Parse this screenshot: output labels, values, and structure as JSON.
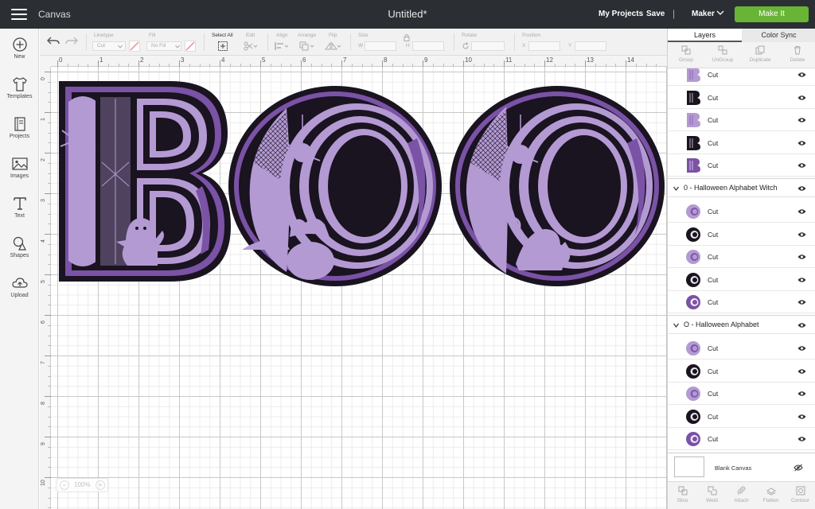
{
  "topbar": {
    "app_title": "Canvas",
    "doc_title": "Untitled*",
    "my_projects": "My Projects",
    "save": "Save",
    "separator": "|",
    "machine": "Maker",
    "make_it": "Make It",
    "make_it_color": "#69b435"
  },
  "sidebar": {
    "items": [
      {
        "label": "New",
        "icon": "plus-circle-icon"
      },
      {
        "label": "Templates",
        "icon": "shirt-icon"
      },
      {
        "label": "Projects",
        "icon": "book-icon"
      },
      {
        "label": "Images",
        "icon": "image-icon"
      },
      {
        "label": "Text",
        "icon": "text-t-icon"
      },
      {
        "label": "Shapes",
        "icon": "shapes-icon"
      },
      {
        "label": "Upload",
        "icon": "cloud-upload-icon"
      }
    ]
  },
  "toolbar": {
    "linetype_label": "Linetype",
    "linetype_value": "Cut",
    "fill_label": "Fill",
    "fill_value": "No Fill",
    "select_all": "Select All",
    "edit": "Edit",
    "align": "Align",
    "arrange": "Arrange",
    "flip": "Flip",
    "size": "Size",
    "size_w": "W",
    "size_h": "H",
    "rotate": "Rotate",
    "position": "Position",
    "pos_x": "X",
    "pos_y": "Y"
  },
  "rulers": {
    "top": [
      "0",
      "1",
      "2",
      "3",
      "4",
      "5",
      "6",
      "7",
      "8",
      "9",
      "10",
      "11",
      "12",
      "13",
      "14"
    ],
    "left": [
      "0",
      "1",
      "2",
      "3",
      "4",
      "5",
      "6",
      "7",
      "8",
      "9",
      "10"
    ]
  },
  "canvas": {
    "artwork_text": "BOO",
    "colors": {
      "dark": "#1a1320",
      "light": "#b49ad3",
      "mid": "#7a52a6"
    }
  },
  "zoom": {
    "value": "100%",
    "minus": "−",
    "plus": "+"
  },
  "panel": {
    "tab_layers": "Layers",
    "tab_color_sync": "Color Sync",
    "actions": [
      "Group",
      "UnGroup",
      "Duplicate",
      "Delete"
    ],
    "rows": [
      {
        "type": "layer",
        "thumb": "B",
        "color": "light",
        "label": "Cut"
      },
      {
        "type": "layer",
        "thumb": "B",
        "color": "dark",
        "label": "Cut"
      },
      {
        "type": "layer",
        "thumb": "B",
        "color": "light",
        "label": "Cut"
      },
      {
        "type": "layer",
        "thumb": "B",
        "color": "dark",
        "label": "Cut"
      },
      {
        "type": "layer",
        "thumb": "B",
        "color": "mid",
        "label": "Cut"
      },
      {
        "type": "group",
        "label": "0 - Halloween Alphabet Witch"
      },
      {
        "type": "layer",
        "thumb": "O",
        "color": "light",
        "label": "Cut"
      },
      {
        "type": "layer",
        "thumb": "O",
        "color": "dark",
        "label": "Cut"
      },
      {
        "type": "layer",
        "thumb": "O",
        "color": "light",
        "label": "Cut"
      },
      {
        "type": "layer",
        "thumb": "O",
        "color": "dark",
        "label": "Cut"
      },
      {
        "type": "layer",
        "thumb": "O",
        "color": "mid",
        "label": "Cut"
      },
      {
        "type": "group",
        "label": "O - Halloween Alphabet"
      },
      {
        "type": "layer",
        "thumb": "O",
        "color": "light",
        "label": "Cut"
      },
      {
        "type": "layer",
        "thumb": "O",
        "color": "dark",
        "label": "Cut"
      },
      {
        "type": "layer",
        "thumb": "O",
        "color": "light",
        "label": "Cut"
      },
      {
        "type": "layer",
        "thumb": "O",
        "color": "dark",
        "label": "Cut"
      },
      {
        "type": "layer",
        "thumb": "O",
        "color": "mid",
        "label": "Cut"
      }
    ],
    "blank_canvas": "Blank Canvas",
    "bottom_actions": [
      "Slice",
      "Weld",
      "Attach",
      "Flatten",
      "Contour"
    ]
  }
}
